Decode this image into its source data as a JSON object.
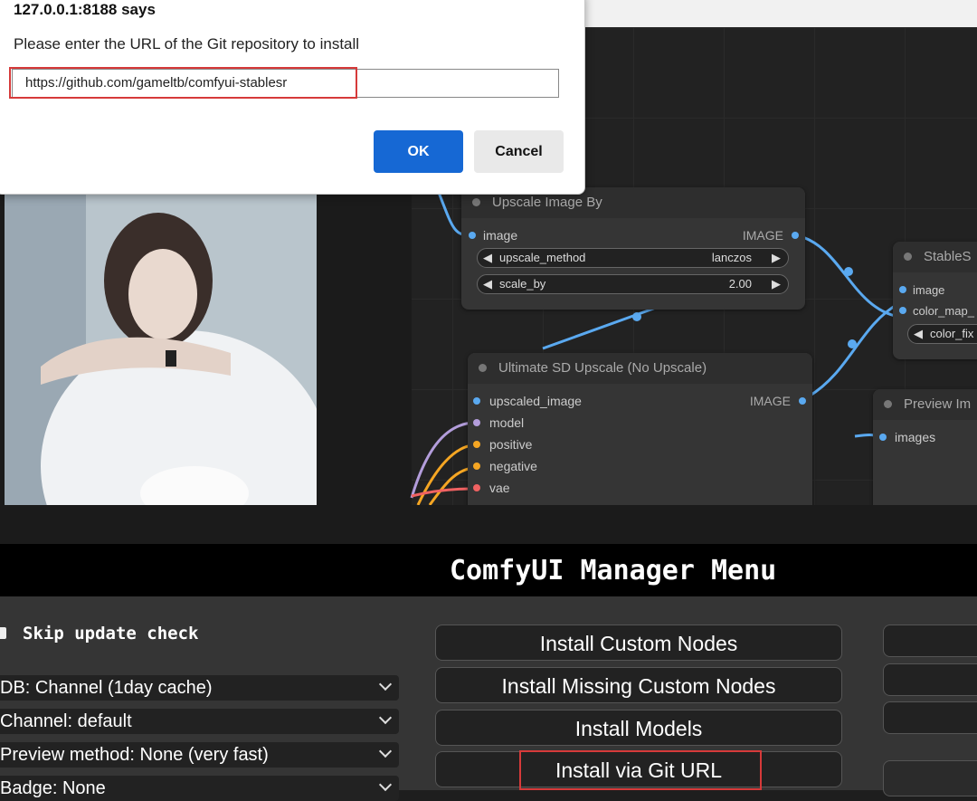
{
  "dialog": {
    "title": "127.0.0.1:8188 says",
    "message": "Please enter the URL of the Git repository to install",
    "input_value": "https://github.com/gameltb/comfyui-stablesr",
    "ok_label": "OK",
    "cancel_label": "Cancel"
  },
  "nodes": {
    "upscale": {
      "title": "Upscale Image By",
      "input": "image",
      "output": "IMAGE",
      "w1_label": "upscale_method",
      "w1_value": "lanczos",
      "w2_label": "scale_by",
      "w2_value": "2.00"
    },
    "ultimate": {
      "title": "Ultimate SD Upscale (No Upscale)",
      "in1": "upscaled_image",
      "in2": "model",
      "in3": "positive",
      "in4": "negative",
      "in5": "vae",
      "output": "IMAGE"
    },
    "stable": {
      "title": "StableS",
      "in1": "image",
      "in2": "color_map_",
      "w1_label": "color_fix"
    },
    "preview": {
      "title": "Preview Im",
      "in1": "images"
    }
  },
  "manager": {
    "title": "ComfyUI Manager Menu",
    "skip_update": "Skip update check",
    "db": "DB: Channel (1day cache)",
    "channel": "Channel: default",
    "preview": "Preview method: None (very fast)",
    "badge": "Badge: None",
    "btn1": "Install Custom Nodes",
    "btn2": "Install Missing Custom Nodes",
    "btn3": "Install Models",
    "btn4": "Install via Git URL"
  },
  "colors": {
    "image_link": "#5aa9f0",
    "model_link": "#b39ddb",
    "cond_link": "#f5a623",
    "vae_link": "#f06262",
    "highlight": "#d63a3a",
    "ok_button": "#1668d4"
  }
}
